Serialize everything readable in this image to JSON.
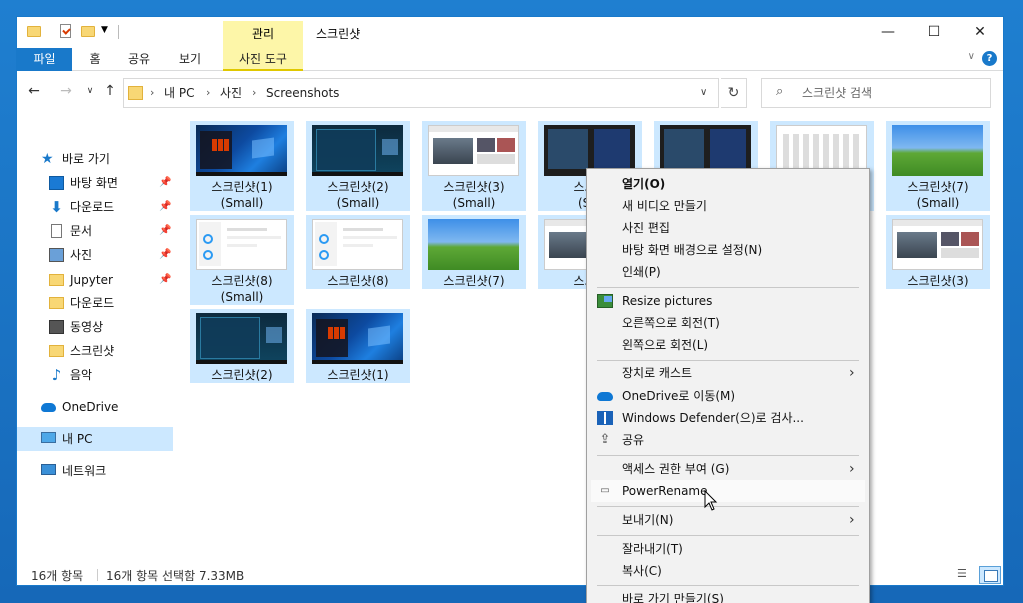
{
  "window": {
    "title": "스크린샷",
    "manage_tab": "관리",
    "minimize": "—",
    "maximize": "☐",
    "close": "✕"
  },
  "ribbon": {
    "tabs": [
      "파일",
      "홈",
      "공유",
      "보기",
      "사진 도구"
    ],
    "help": "?"
  },
  "address": {
    "crumbs": [
      "내 PC",
      "사진",
      "Screenshots"
    ],
    "search_placeholder": "스크린샷 검색"
  },
  "nav": {
    "quick_access": "바로 가기",
    "items": [
      "바탕 화면",
      "다운로드",
      "문서",
      "사진",
      "Jupyter",
      "다운로드",
      "동영상",
      "스크린샷",
      "음악"
    ],
    "onedrive": "OneDrive",
    "thispc": "내 PC",
    "network": "네트워크"
  },
  "files": [
    {
      "name": "스크린샷(1)",
      "sub": "(Small)",
      "thumb": "win-dark"
    },
    {
      "name": "스크린샷(2)",
      "sub": "(Small)",
      "thumb": "teal"
    },
    {
      "name": "스크린샷(3)",
      "sub": "(Small)",
      "thumb": "web"
    },
    {
      "name": "스크린",
      "sub": "(Sm",
      "thumb": "dark-split"
    },
    {
      "name": "",
      "sub": "",
      "thumb": "dark-split"
    },
    {
      "name": "",
      "sub": "",
      "thumb": "grid"
    },
    {
      "name": "스크린샷(7)",
      "sub": "(Small)",
      "thumb": "bliss"
    },
    {
      "name": "스크린샷(8)",
      "sub": "(Small)",
      "thumb": "white"
    },
    {
      "name": "스크린샷(8)",
      "sub": "",
      "thumb": "white"
    },
    {
      "name": "스크린샷(7)",
      "sub": "",
      "thumb": "bliss"
    },
    {
      "name": "스크린",
      "sub": "",
      "thumb": "web"
    },
    {
      "name": "스크린샷(3)",
      "sub": "",
      "thumb": "web"
    },
    {
      "name": "스크린샷(2)",
      "sub": "",
      "thumb": "teal"
    },
    {
      "name": "스크린샷(1)",
      "sub": "",
      "thumb": "win-dark"
    }
  ],
  "status": {
    "count": "16개 항목",
    "selected": "16개 항목 선택함 7.33MB"
  },
  "context_menu": {
    "open": "열기(O)",
    "new_video": "새 비디오 만들기",
    "edit_photo": "사진 편집",
    "set_background": "바탕 화면 배경으로 설정(N)",
    "print": "인쇄(P)",
    "resize": "Resize pictures",
    "rotate_right": "오른쪽으로 회전(T)",
    "rotate_left": "왼쪽으로 회전(L)",
    "cast": "장치로 캐스트",
    "move_onedrive": "OneDrive로 이동(M)",
    "defender": "Windows Defender(으)로 검사...",
    "share": "공유",
    "give_access": "액세스 권한 부여 (G)",
    "powerrename": "PowerRename",
    "send_to": "보내기(N)",
    "cut": "잘라내기(T)",
    "copy": "복사(C)",
    "create_shortcut": "바로 가기 만들기(S)"
  }
}
